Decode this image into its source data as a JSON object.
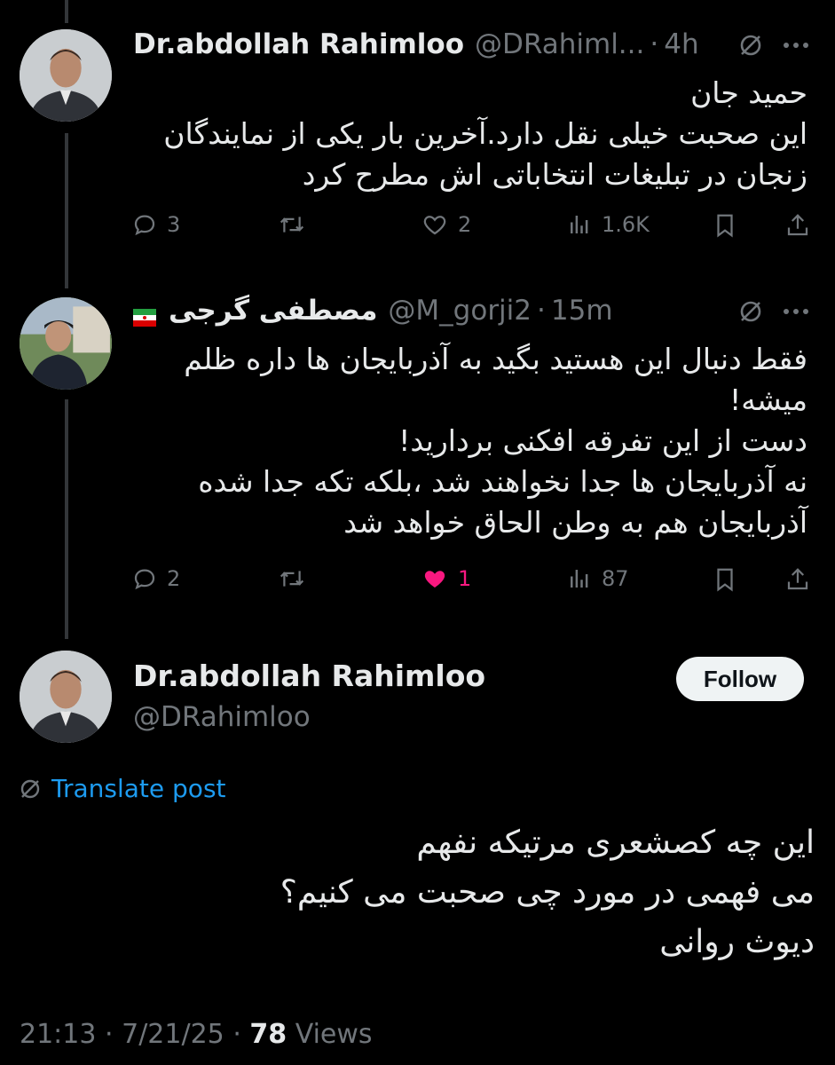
{
  "tweets": [
    {
      "name": "Dr.abdollah Rahimloo",
      "handle": "@DRahiml...",
      "time": "4h",
      "text": [
        "حمید جان",
        "این صحبت خیلی نقل دارد.آخرین بار یکی از نمایندگان",
        "زنجان در تبلیغات انتخاباتی اش مطرح کرد"
      ],
      "replies": "3",
      "retweets": "",
      "likes": "2",
      "views": "1.6K",
      "liked": false
    },
    {
      "name": "مصطفی گرجی",
      "flag": "iran-flag",
      "handle": "@M_gorji2",
      "time": "15m",
      "text": [
        "فقط دنبال این هستید بگید به آذربایجان ها داره ظلم",
        "میشه!",
        "دست از این تفرقه افکنی بردارید!",
        "نه آذربایجان ها جدا نخواهند شد ،بلکه تکه جدا شده",
        "آذربایجان هم به وطن الحاق خواهد شد"
      ],
      "replies": "2",
      "retweets": "",
      "likes": "1",
      "views": "87",
      "liked": true
    }
  ],
  "main_tweet": {
    "name": "Dr.abdollah Rahimloo",
    "handle": "@DRahimloo",
    "follow_label": "Follow",
    "translate_label": "Translate post",
    "text": [
      "این چه کصشعری مرتیکه نفهم",
      "می فهمی در مورد چی صحبت می کنیم؟",
      "دیوث روانی"
    ],
    "time": "21:13",
    "date": "7/21/25",
    "views_count": "78",
    "views_label": "Views"
  },
  "separator": "·",
  "colors": {
    "background": "#000000",
    "text": "#e7e9ea",
    "muted": "#71767b",
    "like": "#f91880",
    "link": "#1d9bf0"
  }
}
